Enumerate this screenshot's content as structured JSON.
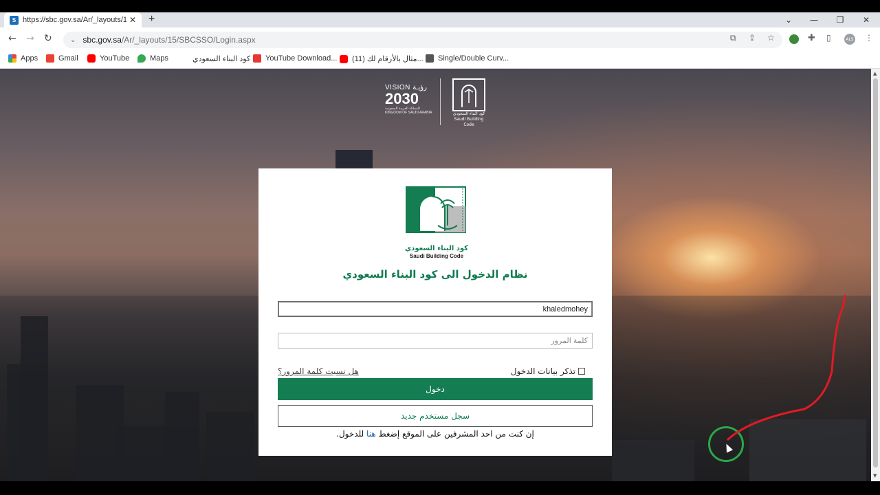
{
  "browser": {
    "tab_title": "https://sbc.gov.sa/Ar/_layouts/15/",
    "tab_favicon": "S",
    "new_tab_label": "+",
    "url_host": "sbc.gov.sa",
    "url_path": "/Ar/_layouts/15/SBCSSO/Login.aspx",
    "profile_initials": "ALS"
  },
  "bookmarks": [
    {
      "label": "Apps",
      "icon": "apps-grid-icon",
      "color": "#4285f4"
    },
    {
      "label": "Gmail",
      "icon": "gmail-icon",
      "color": "#ea4335"
    },
    {
      "label": "YouTube",
      "icon": "youtube-icon",
      "color": "#ff0000"
    },
    {
      "label": "Maps",
      "icon": "maps-icon",
      "color": "#34a853"
    },
    {
      "label": "كود البناء السعودي",
      "icon": "sbc-icon",
      "color": "#ffffff"
    },
    {
      "label": "YouTube Download...",
      "icon": "download-icon",
      "color": "#e53935"
    },
    {
      "label": "(11) مثال بالأرقام لك...",
      "icon": "youtube-icon",
      "color": "#ff0000"
    },
    {
      "label": "Single/Double Curv...",
      "icon": "video-icon",
      "color": "#555555"
    }
  ],
  "logos": {
    "vision_line1": "VISION رؤيـة",
    "vision_year": "2030",
    "vision_sub": "المملكة العربية السعودية KINGDOM OF SAUDI ARABIA",
    "sbc_mini_ar": "كود البناء السعودي",
    "sbc_mini_en": "Saudi Building Code"
  },
  "login": {
    "logo_ar": "كود البناء السعودي",
    "logo_en": "Saudi Building Code",
    "heading": "نظام الدخول الى كود البناء السعودي",
    "username_value": "khaledmohey",
    "password_placeholder": "كلمة المرور",
    "remember_label": "تذكر بيانات الدخول",
    "forgot_label": "هل نسيت كلمة المرور؟",
    "login_button": "دخول",
    "register_button": "سجل مستخدم جديد",
    "admin_note_before": "إن كنت من احد المشرفين على الموقع إضغط ",
    "admin_note_link": "هنا",
    "admin_note_after": " للدخول."
  },
  "colors": {
    "brand_green": "#147d51",
    "heading_green": "#0f7a50",
    "link_blue": "#1a5fa8"
  }
}
